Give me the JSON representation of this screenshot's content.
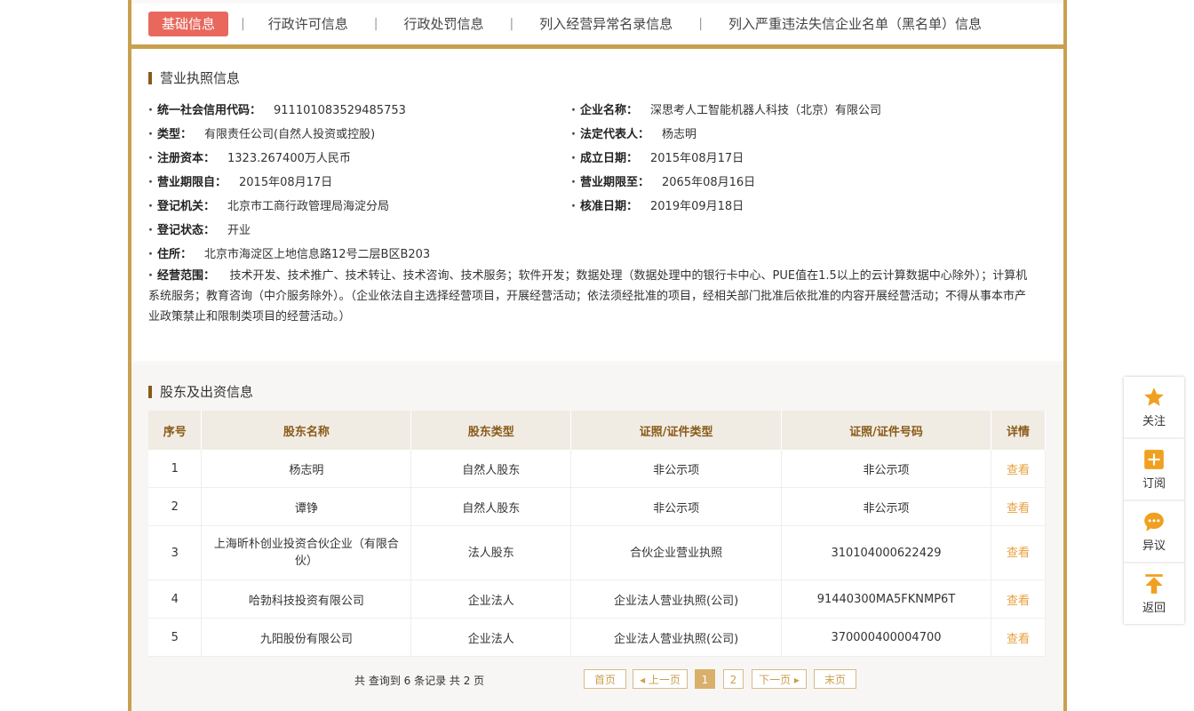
{
  "tabs": [
    {
      "label": "基础信息"
    },
    {
      "label": "行政许可信息"
    },
    {
      "label": "行政处罚信息"
    },
    {
      "label": "列入经营异常名录信息"
    },
    {
      "label": "列入严重违法失信企业名单（黑名单）信息"
    }
  ],
  "license": {
    "title": "营业执照信息",
    "left": [
      {
        "label": "统一社会信用代码：",
        "value": "911101083529485753"
      },
      {
        "label": "类型：",
        "value": "有限责任公司(自然人投资或控股)"
      },
      {
        "label": "注册资本：",
        "value": "1323.267400万人民币"
      },
      {
        "label": "营业期限自：",
        "value": "2015年08月17日"
      },
      {
        "label": "登记机关：",
        "value": "北京市工商行政管理局海淀分局"
      },
      {
        "label": "登记状态：",
        "value": "开业"
      },
      {
        "label": "住所：",
        "value": "北京市海淀区上地信息路12号二层B区B203"
      }
    ],
    "right": [
      {
        "label": "企业名称：",
        "value": "深思考人工智能机器人科技（北京）有限公司"
      },
      {
        "label": "法定代表人：",
        "value": "杨志明"
      },
      {
        "label": "成立日期：",
        "value": "2015年08月17日"
      },
      {
        "label": "营业期限至：",
        "value": "2065年08月16日"
      },
      {
        "label": "核准日期：",
        "value": "2019年09月18日"
      }
    ],
    "scope_label": "经营范围：",
    "scope_value": "技术开发、技术推广、技术转让、技术咨询、技术服务；软件开发；数据处理（数据处理中的银行卡中心、PUE值在1.5以上的云计算数据中心除外）；计算机系统服务；教育咨询（中介服务除外）。（企业依法自主选择经营项目，开展经营活动；依法须经批准的项目，经相关部门批准后依批准的内容开展经营活动；不得从事本市产业政策禁止和限制类项目的经营活动。）"
  },
  "shareholders": {
    "title": "股东及出资信息",
    "headers": [
      "序号",
      "股东名称",
      "股东类型",
      "证照/证件类型",
      "证照/证件号码",
      "详情"
    ],
    "rows": [
      [
        "1",
        "杨志明",
        "自然人股东",
        "非公示项",
        "非公示项",
        "查看"
      ],
      [
        "2",
        "谭铮",
        "自然人股东",
        "非公示项",
        "非公示项",
        "查看"
      ],
      [
        "3",
        "上海昕朴创业投资合伙企业（有限合伙）",
        "法人股东",
        "合伙企业营业执照",
        "310104000622429",
        "查看"
      ],
      [
        "4",
        "哈勃科技投资有限公司",
        "企业法人",
        "企业法人营业执照(公司)",
        "91440300MA5FKNMP6T",
        "查看"
      ],
      [
        "5",
        "九阳股份有限公司",
        "企业法人",
        "企业法人营业执照(公司)",
        "370000400004700",
        "查看"
      ]
    ]
  },
  "pager": {
    "info": "共 查询到 6 条记录 共 2 页",
    "first": "首页",
    "prev": "◂ 上一页",
    "page1": "1",
    "page2": "2",
    "next": "下一页 ▸",
    "last": "末页"
  },
  "float_bar": {
    "follow": "关注",
    "subscribe": "订阅",
    "objection": "异议",
    "back": "返回"
  },
  "colors": {
    "accent": "#c9a04f",
    "active_tab": "#e8685e",
    "link": "#e8a040",
    "icon": "#f0a020"
  }
}
